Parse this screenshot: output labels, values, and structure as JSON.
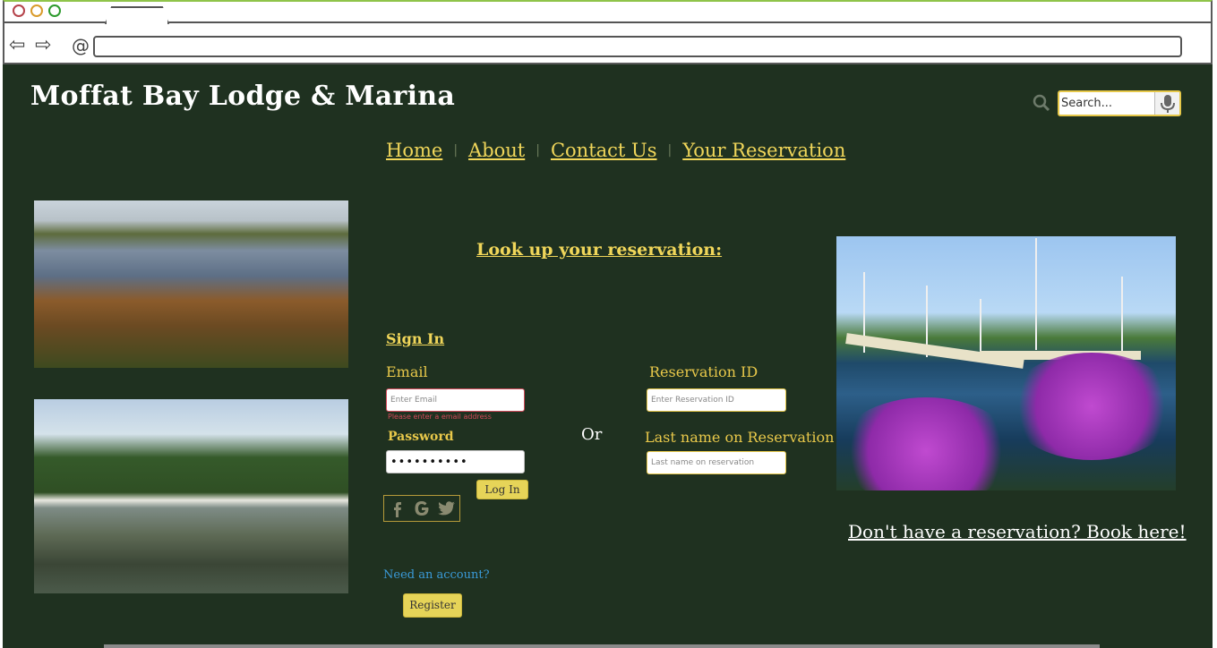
{
  "browser": {
    "back_icon": "arrow-left-icon",
    "forward_icon": "arrow-right-icon",
    "reload_icon": "reload-icon",
    "url": ""
  },
  "header": {
    "site_title": "Moffat Bay Lodge & Marina",
    "search_placeholder": "Search...",
    "search_icon": "magnifier-icon",
    "mic_icon": "microphone-icon"
  },
  "nav": {
    "items": [
      {
        "label": "Home"
      },
      {
        "label": "About"
      },
      {
        "label": "Contact Us"
      },
      {
        "label": "Your Reservation"
      }
    ],
    "separator": "|"
  },
  "main": {
    "lookup_title": "Look up your reservation:",
    "signin": {
      "heading": "Sign In",
      "email_label": "Email",
      "email_placeholder": "Enter Email",
      "email_error": "Please enter a email address",
      "password_label": "Password",
      "password_value": "••••••••••",
      "login_button": "Log In",
      "social_icons": [
        "facebook-icon",
        "google-icon",
        "twitter-icon"
      ],
      "need_account": "Need an account?",
      "register_button": "Register"
    },
    "or_label": "Or",
    "reservation": {
      "id_label": "Reservation ID",
      "id_placeholder": "Enter Reservation ID",
      "lastname_label": "Last name on Reservation",
      "lastname_placeholder": "Last name on reservation"
    },
    "book_link": "Don't have a reservation? Book here!"
  },
  "colors": {
    "page_bg": "#1f3120",
    "accent_yellow": "#f0d65a",
    "button_yellow": "#e6d458",
    "error_red": "#d24a5a",
    "link_blue": "#3a9ad8"
  }
}
